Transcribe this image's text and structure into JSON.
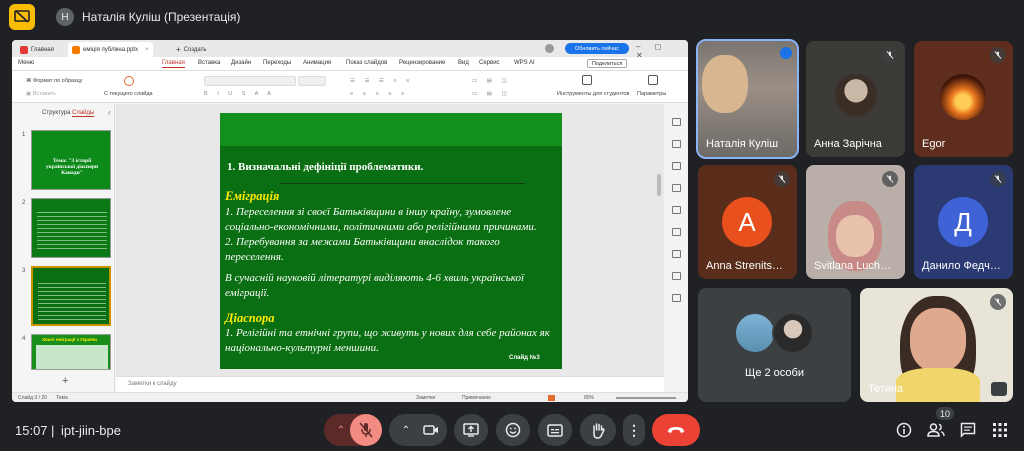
{
  "meeting": {
    "presenter_initial": "Н",
    "presentation_title": "Наталія Куліш (Презентація)",
    "time": "15:07",
    "separator": "|",
    "code": "ipt-jiin-bpe",
    "participants_count": "10"
  },
  "wps": {
    "tabs": [
      {
        "label": "Главная"
      },
      {
        "label": "еміція публікна.pptx"
      }
    ],
    "new_tab": "Создать",
    "update_button": "Обновить сейчас",
    "menus": [
      "Меню",
      "Главная",
      "Вставка",
      "Дизайн",
      "Переходы",
      "Анимация",
      "Показ слайдов",
      "Рецензирование",
      "Вид",
      "Сервис",
      "WPS AI"
    ],
    "share": "Поделиться",
    "toolbar": {
      "format_painter": "Формат по образцу",
      "paste": "Вставить",
      "from_current": "С текущего слайда",
      "student_tools": "Инструменты для студентов",
      "params": "Параметры"
    },
    "sidepanel_tabs": [
      "Структура",
      "Слайды"
    ],
    "thumb_numbers": [
      "1",
      "2",
      "3",
      "4"
    ],
    "thumb1_title": "Тема: \"З історії української діаспори Канади\"",
    "thumb4_title": "Хвилі еміграції з України",
    "notes_placeholder": "Заметки к слайду",
    "status": {
      "slide": "Слайд 3 / 20",
      "theme": "Тема",
      "notes": "Заметки",
      "comments": "Примечание",
      "zoom": "80%"
    }
  },
  "slide": {
    "title": "1. Визначальні дефініції проблематики.",
    "heading1": "Еміграція",
    "p1": "1. Переселення зі своєї Батьківщини в іншу країну, зумовлене соціально-економічними, політичними або релігійними причинами.",
    "p2": "2. Перебування за межами Батьківщини внаслідок такого переселення.",
    "p3": "В сучасній науковій літературі виділяють 4-6 хвиль української еміграції.",
    "heading2": "Діаспора",
    "p4": "1. Релігійні та етнічні групи, що живуть у нових для себе районах як національно-культурні меншини.",
    "number": "Слайд №3"
  },
  "tiles": [
    {
      "name": "Наталія Куліш"
    },
    {
      "name": "Анна Зарічна"
    },
    {
      "name": "Egor"
    },
    {
      "name": "Anna Strenits…",
      "letter": "А",
      "color": "#e8501e"
    },
    {
      "name": "Svitlana Luch…"
    },
    {
      "name": "Данило Федч…",
      "letter": "Д",
      "color": "#3f63d6"
    },
    {
      "name": "Ще 2 особи"
    },
    {
      "name": "Тетяна"
    }
  ],
  "colors": {
    "end_call": "#ea4335",
    "muted_mic": "#f28b82",
    "accent": "#1a73e8"
  }
}
